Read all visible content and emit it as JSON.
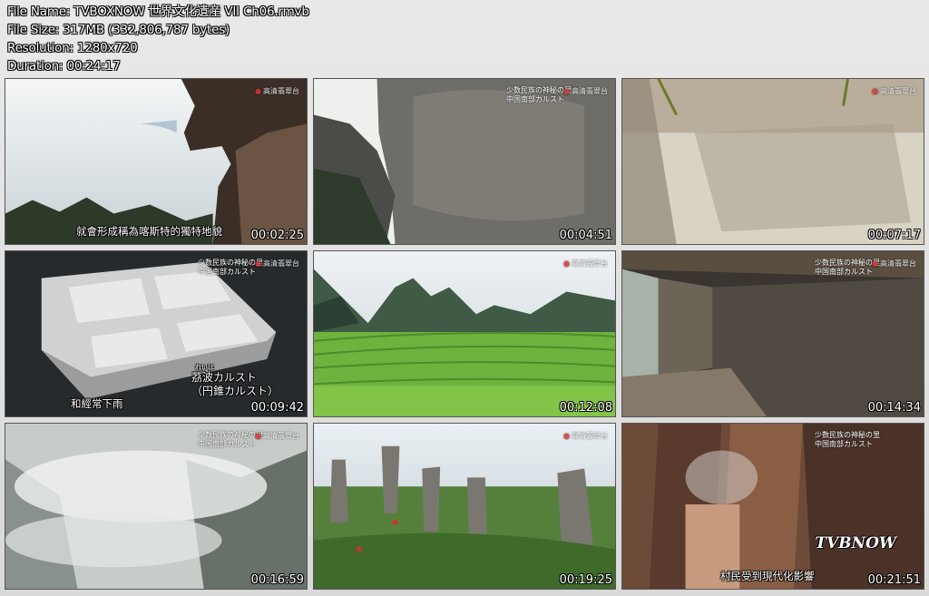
{
  "file_info": {
    "file_name": "File Name: TVBOXNOW 世界文化遺産 VII Ch06.rmvb",
    "file_size": "File Size: 317MB (332,806,787 bytes)",
    "resolution": "Resolution: 1280x720",
    "duration": "Duration: 00:24:17"
  },
  "thumbnails": [
    {
      "time": "00:02:25",
      "subtitle": "就會形成稱為喀斯特的獨特地貌",
      "logo": "高清翡翠台"
    },
    {
      "time": "00:04:51",
      "tag1": "少数民族の神秘の里",
      "tag2": "中国南部カルスト",
      "logo": "高清翡翠台"
    },
    {
      "time": "00:07:17",
      "logo": "高清翡翠台"
    },
    {
      "time": "00:09:42",
      "tag1": "少数民族の神秘の里",
      "tag2": "中国南部カルスト",
      "logo": "高清翡翠台",
      "subtitle": "和經常下雨",
      "caption_ruby": "れいは",
      "caption1": "茘波カルスト",
      "caption2": "（円錐カルスト）"
    },
    {
      "time": "00:12:08",
      "logo": "高清翡翠台"
    },
    {
      "time": "00:14:34",
      "tag1": "少数民族の神秘の里",
      "tag2": "中国南部カルスト",
      "logo": "高清翡翠台"
    },
    {
      "time": "00:16:59",
      "tag1": "少数民族の神秘の里",
      "tag2": "中国南部カルスト",
      "logo": "高清翡翠台"
    },
    {
      "time": "00:19:25",
      "logo": "高清翡翠台"
    },
    {
      "time": "00:21:51",
      "tag1": "少数民族の神秘の里",
      "tag2": "中国南部カルスト",
      "subtitle": "村民受到現代化影響",
      "watermark": "TVBNOW"
    }
  ]
}
